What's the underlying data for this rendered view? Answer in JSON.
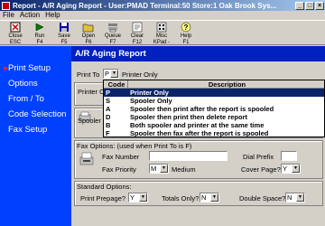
{
  "window": {
    "title": "Report - A/R Aging Report - User:PMAD Terminal:50 Store:1 Oak Brook Sys..."
  },
  "menu": [
    "File",
    "Action",
    "Help"
  ],
  "toolbar": [
    {
      "label1": "Close",
      "label2": "ESC",
      "icon": "close-icon"
    },
    {
      "label1": "Run",
      "label2": "F4",
      "icon": "run-icon"
    },
    {
      "label1": "Save",
      "label2": "F5",
      "icon": "save-icon"
    },
    {
      "label1": "Open",
      "label2": "F6",
      "icon": "open-icon"
    },
    {
      "label1": "Queue",
      "label2": "F7",
      "icon": "queue-icon"
    },
    {
      "label1": "Clear",
      "label2": "F12",
      "icon": "clear-icon"
    },
    {
      "label1": "Misc",
      "label2": "KPad -",
      "icon": "misc-icon"
    },
    {
      "label1": "Help",
      "label2": "F1",
      "icon": "help-icon"
    }
  ],
  "sidebar": {
    "items": [
      {
        "label": "Print Setup",
        "active": true
      },
      {
        "label": "Options"
      },
      {
        "label": "From / To"
      },
      {
        "label": "Code Selection"
      },
      {
        "label": "Fax Setup"
      }
    ]
  },
  "main": {
    "header": "A/R Aging Report",
    "print_to": {
      "label": "Print To",
      "value": "P",
      "description": "Printer Only"
    },
    "printer_option_label": "Printer Op",
    "spooler_label": "Spooler O",
    "dropdown": {
      "columns": [
        "Code",
        "Description"
      ],
      "rows": [
        {
          "code": "P",
          "desc": "Printer Only",
          "selected": true
        },
        {
          "code": "S",
          "desc": "Spooler Only"
        },
        {
          "code": "A",
          "desc": "Spooler then print after the report is spooled"
        },
        {
          "code": "D",
          "desc": "Spooler then print then delete report"
        },
        {
          "code": "B",
          "desc": "Both spooler and printer at the same time"
        },
        {
          "code": "F",
          "desc": "Spooler then fax after the report is spooled"
        }
      ]
    },
    "fax": {
      "title": "Fax Options: (used when Print To is F)",
      "number_label": "Fax Number",
      "priority_label": "Fax Priority",
      "priority_value": "M",
      "priority_desc": "Medium",
      "dial_prefix_label": "Dial Prefix",
      "cover_page_label": "Cover Page?",
      "cover_page_value": "Y"
    },
    "standard": {
      "title": "Standard Options:",
      "prepage_label": "Print Prepage?",
      "prepage_value": "Y",
      "totals_label": "Totals Only?",
      "totals_value": "N",
      "double_label": "Double Space?",
      "double_value": "N"
    }
  },
  "colors": {
    "sidebar": "#0040ff",
    "header": "#0020c0",
    "selection": "#0a246a"
  }
}
